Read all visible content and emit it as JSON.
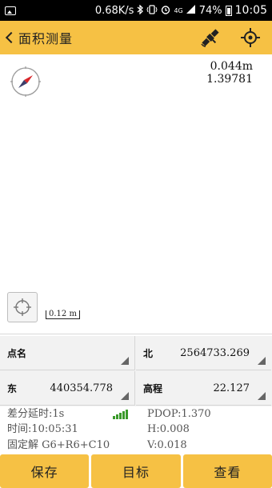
{
  "status_bar": {
    "speed": "0.68K/s",
    "network": "4G",
    "battery": "74%",
    "time": "10:05",
    "icons": [
      "image-icon",
      "bluetooth-icon",
      "vibrate-icon",
      "alarm-icon",
      "signal-icon",
      "battery-icon"
    ]
  },
  "header": {
    "title": "面积测量",
    "icons": [
      "back-chevron-icon",
      "satellite-icon",
      "target-crosshair-icon"
    ]
  },
  "map": {
    "readout_distance": "0.044m",
    "readout_value": "1.39781",
    "scale_label": "0.12 m",
    "icons": [
      "compass-icon",
      "locate-icon"
    ]
  },
  "fields": {
    "point_name": {
      "label": "点名",
      "value": ""
    },
    "north": {
      "label": "北",
      "value": "2564733.269"
    },
    "east": {
      "label": "东",
      "value": "440354.778"
    },
    "elevation": {
      "label": "高程",
      "value": "22.127"
    }
  },
  "info": {
    "diff_delay": "差分延时:1s",
    "pdop": "PDOP:1.370",
    "time": "时间:10:05:31",
    "h": "H:0.008",
    "solution": "固定解  G6+R6+C10",
    "v": "V:0.018",
    "signal_color": "#3a9a2a"
  },
  "buttons": {
    "save": "保存",
    "target": "目标",
    "view": "查看"
  },
  "colors": {
    "accent": "#f6c144"
  }
}
